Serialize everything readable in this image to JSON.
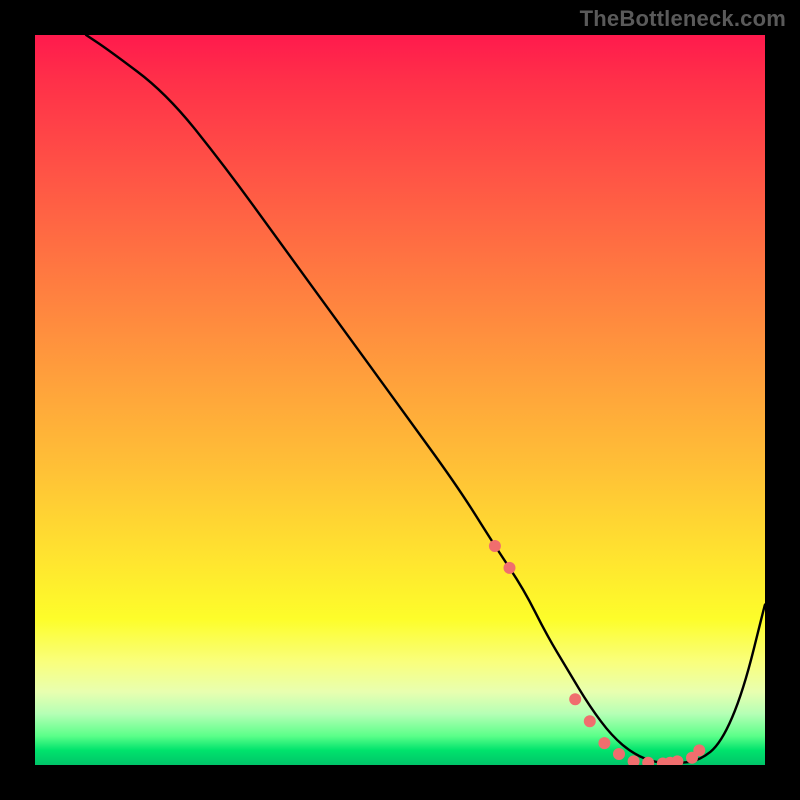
{
  "watermark": "TheBottleneck.com",
  "chart_data": {
    "type": "line",
    "title": "",
    "xlabel": "",
    "ylabel": "",
    "xlim": [
      0,
      100
    ],
    "ylim": [
      0,
      100
    ],
    "series": [
      {
        "name": "bottleneck-curve",
        "x": [
          7,
          10,
          18,
          26,
          34,
          42,
          50,
          58,
          63,
          67,
          70,
          73,
          76,
          79,
          82,
          85,
          88,
          91,
          94,
          97,
          100
        ],
        "values": [
          100,
          98,
          92,
          82,
          71,
          60,
          49,
          38,
          30,
          24,
          18,
          13,
          8,
          4,
          1.5,
          0.3,
          0.2,
          0.6,
          3,
          10,
          22
        ],
        "color": "#000000"
      }
    ],
    "markers": {
      "name": "highlight-dots",
      "x": [
        63,
        65,
        74,
        76,
        78,
        80,
        82,
        84,
        86,
        87,
        88,
        90,
        91
      ],
      "values": [
        30,
        27,
        9,
        6,
        3,
        1.5,
        0.5,
        0.3,
        0.2,
        0.3,
        0.5,
        1.0,
        2.0
      ],
      "color": "#f06e6e",
      "radius": 6
    },
    "gradient_stops": [
      {
        "pct": 0,
        "color": "#ff1a4d"
      },
      {
        "pct": 18,
        "color": "#ff5146"
      },
      {
        "pct": 46,
        "color": "#ff9d3c"
      },
      {
        "pct": 72,
        "color": "#ffe52f"
      },
      {
        "pct": 86,
        "color": "#f9ff7e"
      },
      {
        "pct": 96,
        "color": "#5cff8a"
      },
      {
        "pct": 100,
        "color": "#00c469"
      }
    ]
  }
}
